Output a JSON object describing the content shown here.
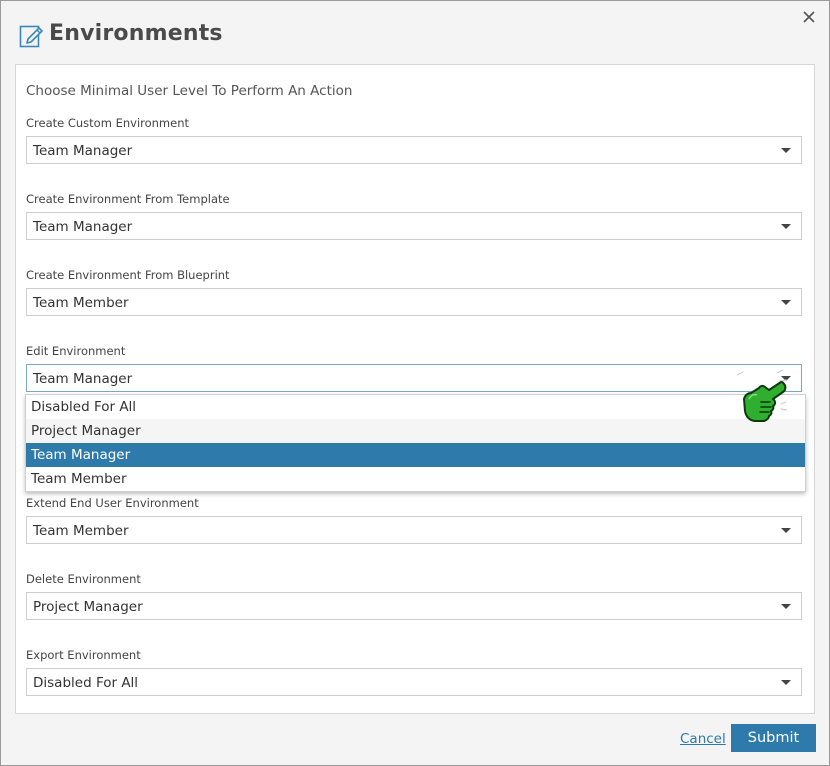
{
  "dialog": {
    "title": "Environments",
    "title_icon": "edit-icon",
    "close_icon": "close-icon",
    "instructions": "Choose Minimal User Level To Perform An Action"
  },
  "fields": [
    {
      "label": "Create Custom Environment",
      "value": "Team Manager"
    },
    {
      "label": "Create Environment From Template",
      "value": "Team Manager"
    },
    {
      "label": "Create Environment From Blueprint",
      "value": "Team Member"
    },
    {
      "label": "Edit Environment",
      "value": "Team Manager"
    },
    {
      "label": "Extend End User Environment",
      "value": "Team Member"
    },
    {
      "label": "Delete Environment",
      "value": "Project Manager"
    },
    {
      "label": "Export Environment",
      "value": "Disabled For All"
    }
  ],
  "dropdown": {
    "options": [
      "Disabled For All",
      "Project Manager",
      "Team Manager",
      "Team Member"
    ],
    "selected": "Team Manager"
  },
  "footer": {
    "cancel_label": "Cancel",
    "submit_label": "Submit"
  },
  "colors": {
    "accent": "#2e7aab",
    "cursor_green": "#2fae2f"
  }
}
